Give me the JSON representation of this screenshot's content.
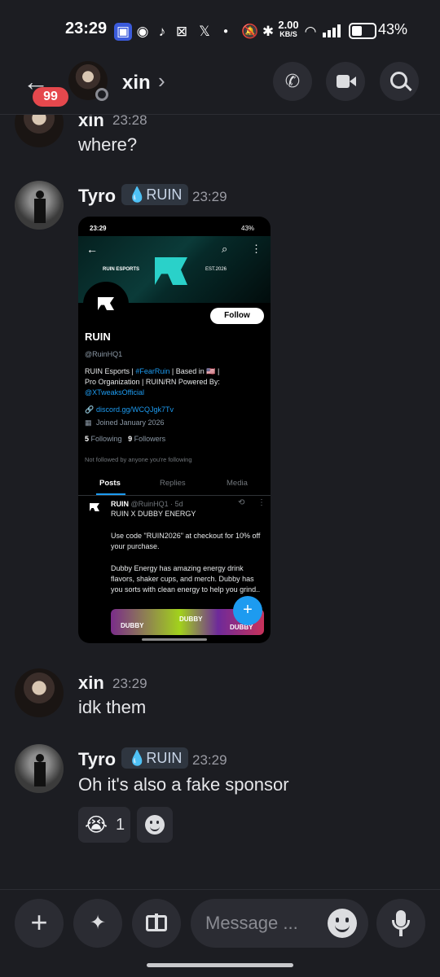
{
  "status_bar": {
    "time": "23:29",
    "speed": "2.00",
    "speed_unit": "KB/S",
    "battery": "43%"
  },
  "header": {
    "back_badge": "99",
    "title": "xin",
    "chevron": "›"
  },
  "messages": [
    {
      "author": "xin",
      "time": "23:28",
      "text": "where?"
    },
    {
      "author": "Tyro",
      "tag": "RUIN",
      "time": "23:29"
    },
    {
      "author": "xin",
      "time": "23:29",
      "text": "idk them"
    },
    {
      "author": "Tyro",
      "tag": "RUIN",
      "time": "23:29",
      "text": "Oh it's also a fake sponsor"
    }
  ],
  "reaction": {
    "emoji": "😭",
    "count": "1"
  },
  "embed": {
    "status_time": "23:29",
    "battery": "43%",
    "banner_left": "RUIN ESPORTS",
    "banner_right": "EST.2026",
    "follow": "Follow",
    "profile_name": "RUIN",
    "handle": "@RuinHQ1",
    "bio_1a": "RUIN Esports | ",
    "bio_1b": "#FearRuin",
    "bio_1c": " | Based in 🇺🇸 |",
    "bio_2": "Pro Organization | RUIN/RN Powered By:",
    "bio_3": "@XTweaksOfficial",
    "link": "discord.gg/WCQJgk7Tv",
    "joined": "Joined January 2026",
    "following_count": "5",
    "following_label": "Following",
    "followers_count": "9",
    "followers_label": "Followers",
    "not_followed": "Not followed by anyone you're following",
    "tabs": [
      "Posts",
      "Replies",
      "Media"
    ],
    "post_author": "RUIN",
    "post_meta": "@RuinHQ1 · 5d",
    "post_title": "RUIN X DUBBY ENERGY",
    "post_p1": "Use code \"RUIN2026\" at checkout for 10% off your purchase.",
    "post_p2": "Dubby Energy has amazing energy drink flavors, shaker cups, and merch. Dubby has you sorts with clean energy to help you grind..",
    "image_text_1": "DUBBY",
    "image_text_2": "DUBBY",
    "image_text_3": "DUBBY"
  },
  "input": {
    "placeholder": "Message ..."
  },
  "colors": {
    "bg": "#1c1d22",
    "surface": "#2b2c33",
    "badge": "#e5484d",
    "link": "#1d9bf0",
    "accent": "#2ad1c9"
  }
}
